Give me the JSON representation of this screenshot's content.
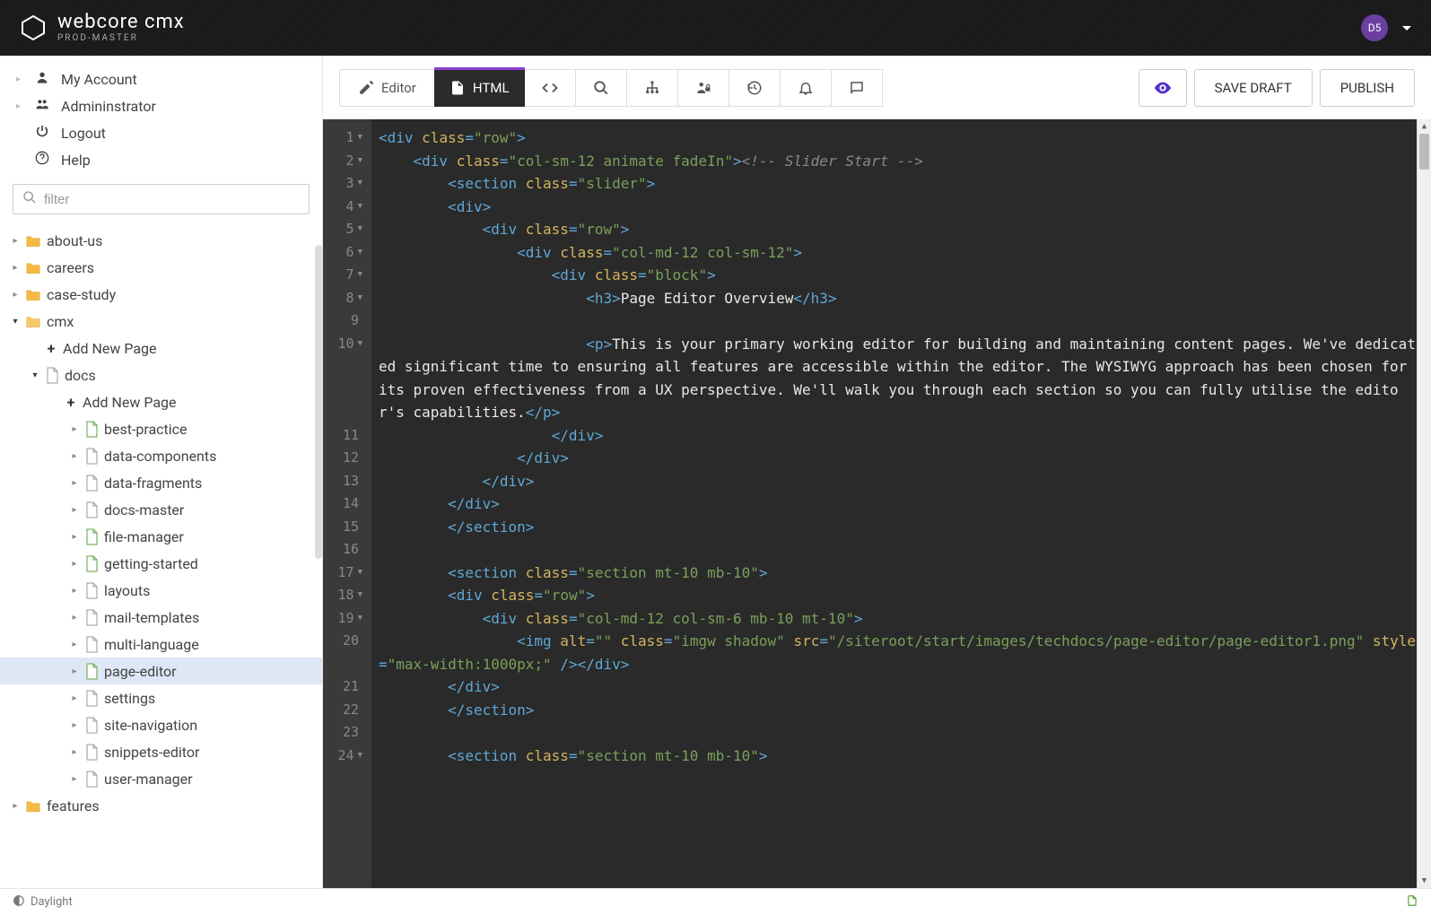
{
  "brand": {
    "title": "webcore cmx",
    "subtitle": "PROD-MASTER"
  },
  "user": {
    "initials": "D5"
  },
  "account_menu": [
    {
      "icon": "user",
      "label": "My Account",
      "caret": true
    },
    {
      "icon": "users",
      "label": "Admininstrator",
      "caret": true
    },
    {
      "icon": "power",
      "label": "Logout",
      "caret": false
    },
    {
      "icon": "help",
      "label": "Help",
      "caret": false
    }
  ],
  "filter": {
    "placeholder": "filter"
  },
  "tree": [
    {
      "type": "folder",
      "label": "about-us",
      "indent": 0,
      "open": false
    },
    {
      "type": "folder",
      "label": "careers",
      "indent": 0,
      "open": false
    },
    {
      "type": "folder",
      "label": "case-study",
      "indent": 0,
      "open": false
    },
    {
      "type": "folder",
      "label": "cmx",
      "indent": 0,
      "open": true
    },
    {
      "type": "add",
      "label": "Add New Page",
      "indent": 1
    },
    {
      "type": "file",
      "label": "docs",
      "indent": 1,
      "open": true,
      "gray": true
    },
    {
      "type": "add",
      "label": "Add New Page",
      "indent": 2
    },
    {
      "type": "file",
      "label": "best-practice",
      "indent": 3,
      "green": true
    },
    {
      "type": "file",
      "label": "data-components",
      "indent": 3,
      "gray": true
    },
    {
      "type": "file",
      "label": "data-fragments",
      "indent": 3,
      "gray": true
    },
    {
      "type": "file",
      "label": "docs-master",
      "indent": 3,
      "gray": true
    },
    {
      "type": "file",
      "label": "file-manager",
      "indent": 3,
      "green": true
    },
    {
      "type": "file",
      "label": "getting-started",
      "indent": 3,
      "green": true
    },
    {
      "type": "file",
      "label": "layouts",
      "indent": 3,
      "gray": true
    },
    {
      "type": "file",
      "label": "mail-templates",
      "indent": 3,
      "gray": true
    },
    {
      "type": "file",
      "label": "multi-language",
      "indent": 3,
      "gray": true
    },
    {
      "type": "file",
      "label": "page-editor",
      "indent": 3,
      "green": true,
      "selected": true
    },
    {
      "type": "file",
      "label": "settings",
      "indent": 3,
      "gray": true
    },
    {
      "type": "file",
      "label": "site-navigation",
      "indent": 3,
      "gray": true
    },
    {
      "type": "file",
      "label": "snippets-editor",
      "indent": 3,
      "gray": true
    },
    {
      "type": "file",
      "label": "user-manager",
      "indent": 3,
      "gray": true
    },
    {
      "type": "folder",
      "label": "features",
      "indent": 0,
      "open": false
    }
  ],
  "toolbar": {
    "editor_label": "Editor",
    "html_label": "HTML",
    "preview_label": "Preview",
    "save_draft": "SAVE DRAFT",
    "publish": "PUBLISH"
  },
  "code": {
    "gutter": [
      {
        "n": "1",
        "f": true
      },
      {
        "n": "2",
        "f": true
      },
      {
        "n": "3",
        "f": true
      },
      {
        "n": "4",
        "f": true
      },
      {
        "n": "5",
        "f": true
      },
      {
        "n": "6",
        "f": true
      },
      {
        "n": "7",
        "f": true
      },
      {
        "n": "8",
        "f": true
      },
      {
        "n": "9",
        "f": false
      },
      {
        "n": "10",
        "f": true
      },
      {
        "n": "",
        "f": false
      },
      {
        "n": "",
        "f": false
      },
      {
        "n": "",
        "f": false
      },
      {
        "n": "11",
        "f": false
      },
      {
        "n": "12",
        "f": false
      },
      {
        "n": "13",
        "f": false
      },
      {
        "n": "14",
        "f": false
      },
      {
        "n": "15",
        "f": false
      },
      {
        "n": "16",
        "f": false
      },
      {
        "n": "17",
        "f": true
      },
      {
        "n": "18",
        "f": true
      },
      {
        "n": "19",
        "f": true
      },
      {
        "n": "20",
        "f": false
      },
      {
        "n": "",
        "f": false
      },
      {
        "n": "21",
        "f": false
      },
      {
        "n": "22",
        "f": false
      },
      {
        "n": "23",
        "f": false
      },
      {
        "n": "24",
        "f": true
      }
    ],
    "lines": [
      [
        {
          "c": "t",
          "t": "<div "
        },
        {
          "c": "a",
          "t": "class"
        },
        {
          "c": "t",
          "t": "="
        },
        {
          "c": "s",
          "t": "\"row\""
        },
        {
          "c": "t",
          "t": ">"
        }
      ],
      [
        {
          "c": "",
          "t": "    "
        },
        {
          "c": "t",
          "t": "<div "
        },
        {
          "c": "a",
          "t": "class"
        },
        {
          "c": "t",
          "t": "="
        },
        {
          "c": "s",
          "t": "\"col-sm-12 animate fadeIn\""
        },
        {
          "c": "t",
          "t": ">"
        },
        {
          "c": "c",
          "t": "<!-- Slider Start -->"
        }
      ],
      [
        {
          "c": "",
          "t": "        "
        },
        {
          "c": "t",
          "t": "<section "
        },
        {
          "c": "a",
          "t": "class"
        },
        {
          "c": "t",
          "t": "="
        },
        {
          "c": "s",
          "t": "\"slider\""
        },
        {
          "c": "t",
          "t": ">"
        }
      ],
      [
        {
          "c": "",
          "t": "        "
        },
        {
          "c": "t",
          "t": "<div>"
        }
      ],
      [
        {
          "c": "",
          "t": "            "
        },
        {
          "c": "t",
          "t": "<div "
        },
        {
          "c": "a",
          "t": "class"
        },
        {
          "c": "t",
          "t": "="
        },
        {
          "c": "s",
          "t": "\"row\""
        },
        {
          "c": "t",
          "t": ">"
        }
      ],
      [
        {
          "c": "",
          "t": "                "
        },
        {
          "c": "t",
          "t": "<div "
        },
        {
          "c": "a",
          "t": "class"
        },
        {
          "c": "t",
          "t": "="
        },
        {
          "c": "s",
          "t": "\"col-md-12 col-sm-12\""
        },
        {
          "c": "t",
          "t": ">"
        }
      ],
      [
        {
          "c": "",
          "t": "                    "
        },
        {
          "c": "t",
          "t": "<div "
        },
        {
          "c": "a",
          "t": "class"
        },
        {
          "c": "t",
          "t": "="
        },
        {
          "c": "s",
          "t": "\"block\""
        },
        {
          "c": "t",
          "t": ">"
        }
      ],
      [
        {
          "c": "",
          "t": "                        "
        },
        {
          "c": "t",
          "t": "<h3>"
        },
        {
          "c": "",
          "t": "Page Editor Overview"
        },
        {
          "c": "t",
          "t": "</h3>"
        }
      ],
      [
        {
          "c": "",
          "t": ""
        }
      ],
      [
        {
          "c": "",
          "t": "                        "
        },
        {
          "c": "t",
          "t": "<p>"
        },
        {
          "c": "",
          "t": "This is your primary working editor for building and maintaining content pages. We've dedicated significant time to ensuring all features are accessible within the editor. The WYSIWYG approach has been chosen for its proven effectiveness from a UX perspective. We'll walk you through each section so you can fully utilise the editor's capabilities."
        },
        {
          "c": "t",
          "t": "</p>"
        }
      ],
      [
        {
          "c": "",
          "t": "                    "
        },
        {
          "c": "t",
          "t": "</div>"
        }
      ],
      [
        {
          "c": "",
          "t": "                "
        },
        {
          "c": "t",
          "t": "</div>"
        }
      ],
      [
        {
          "c": "",
          "t": "            "
        },
        {
          "c": "t",
          "t": "</div>"
        }
      ],
      [
        {
          "c": "",
          "t": "        "
        },
        {
          "c": "t",
          "t": "</div>"
        }
      ],
      [
        {
          "c": "",
          "t": "        "
        },
        {
          "c": "t",
          "t": "</section>"
        }
      ],
      [
        {
          "c": "",
          "t": ""
        }
      ],
      [
        {
          "c": "",
          "t": "        "
        },
        {
          "c": "t",
          "t": "<section "
        },
        {
          "c": "a",
          "t": "class"
        },
        {
          "c": "t",
          "t": "="
        },
        {
          "c": "s",
          "t": "\"section mt-10 mb-10\""
        },
        {
          "c": "t",
          "t": ">"
        }
      ],
      [
        {
          "c": "",
          "t": "        "
        },
        {
          "c": "t",
          "t": "<div "
        },
        {
          "c": "a",
          "t": "class"
        },
        {
          "c": "t",
          "t": "="
        },
        {
          "c": "s",
          "t": "\"row\""
        },
        {
          "c": "t",
          "t": ">"
        }
      ],
      [
        {
          "c": "",
          "t": "            "
        },
        {
          "c": "t",
          "t": "<div "
        },
        {
          "c": "a",
          "t": "class"
        },
        {
          "c": "t",
          "t": "="
        },
        {
          "c": "s",
          "t": "\"col-md-12 col-sm-6 mb-10 mt-10\""
        },
        {
          "c": "t",
          "t": ">"
        }
      ],
      [
        {
          "c": "",
          "t": "                "
        },
        {
          "c": "t",
          "t": "<img "
        },
        {
          "c": "a",
          "t": "alt"
        },
        {
          "c": "t",
          "t": "="
        },
        {
          "c": "s",
          "t": "\"\""
        },
        {
          "c": "t",
          "t": " "
        },
        {
          "c": "a",
          "t": "class"
        },
        {
          "c": "t",
          "t": "="
        },
        {
          "c": "s",
          "t": "\"imgw shadow\""
        },
        {
          "c": "t",
          "t": " "
        },
        {
          "c": "a",
          "t": "src"
        },
        {
          "c": "t",
          "t": "="
        },
        {
          "c": "s",
          "t": "\"/siteroot/start/images/techdocs/page-editor/page-editor1.png\""
        },
        {
          "c": "t",
          "t": " "
        },
        {
          "c": "a",
          "t": "style"
        },
        {
          "c": "t",
          "t": "="
        },
        {
          "c": "s",
          "t": "\"max-width:1000px;\""
        },
        {
          "c": "t",
          "t": " />"
        },
        {
          "c": "t",
          "t": "</div>"
        }
      ],
      [
        {
          "c": "",
          "t": "        "
        },
        {
          "c": "t",
          "t": "</div>"
        }
      ],
      [
        {
          "c": "",
          "t": "        "
        },
        {
          "c": "t",
          "t": "</section>"
        }
      ],
      [
        {
          "c": "",
          "t": ""
        }
      ],
      [
        {
          "c": "",
          "t": "        "
        },
        {
          "c": "t",
          "t": "<section "
        },
        {
          "c": "a",
          "t": "class"
        },
        {
          "c": "t",
          "t": "="
        },
        {
          "c": "s",
          "t": "\"section mt-10 mb-10\""
        },
        {
          "c": "t",
          "t": ">"
        }
      ]
    ]
  },
  "footer": {
    "label": "Daylight"
  }
}
